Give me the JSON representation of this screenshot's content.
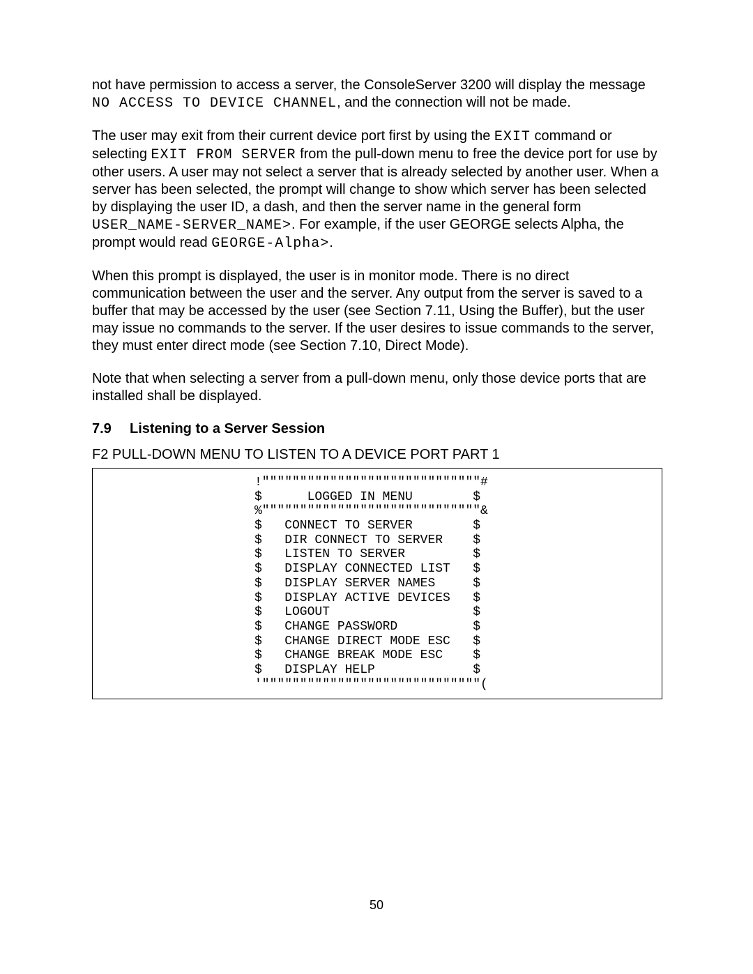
{
  "para1": {
    "t1": "not have permission to access a server, the ConsoleServer 3200 will display the message ",
    "code1": "NO ACCESS TO DEVICE CHANNEL",
    "t2": ", and the connection will not be made."
  },
  "para2": {
    "t1": "The user may exit from their current device port first by using the ",
    "code1": "EXIT",
    "t2": " command or selecting ",
    "code2": "EXIT FROM SERVER",
    "t3": " from the pull-down menu to free the device port for use by other users.  A user may not select a server that is already selected by another user.  When a server has been selected, the prompt will change to show which server has been selected by displaying the user ID, a dash, and then the server name in the general form ",
    "code3": "USER_NAME-SERVER_NAME>",
    "t4": ".  For example, if the user GEORGE selects Alpha, the prompt would read ",
    "code4": "GEORGE-Alpha>",
    "t5": "."
  },
  "para3": {
    "t1": "When this prompt is displayed, the user is in monitor mode.  There is no direct communication between the user and the server.  Any output from the server is saved to a buffer that may be accessed by the user (see Section 7.11, Using the Buffer), but the user may issue no commands to the server.  If the user desires to issue commands to the server, they must enter direct mode (see Section 7.10, Direct Mode)."
  },
  "para4": {
    "t1": "Note that when selecting a server from a pull-down menu, only those device ports that are installed shall be displayed."
  },
  "section": {
    "num": "7.9",
    "title": "Listening to a Server Session"
  },
  "figure": {
    "title": "F2 PULL-DOWN MENU TO LISTEN TO A DEVICE PORT PART 1"
  },
  "menu": {
    "l0": "!\"\"\"\"\"\"\"\"\"\"\"\"\"\"\"\"\"\"\"\"\"\"\"\"\"\"\"\"\"#",
    "l1": "$      LOGGED IN MENU        $",
    "l2": "%\"\"\"\"\"\"\"\"\"\"\"\"\"\"\"\"\"\"\"\"\"\"\"\"\"\"\"\"\"&",
    "l3": "$   CONNECT TO SERVER        $",
    "l4": "$   DIR CONNECT TO SERVER    $",
    "l5": "$   LISTEN TO SERVER         $",
    "l6": "$   DISPLAY CONNECTED LIST   $",
    "l7": "$   DISPLAY SERVER NAMES     $",
    "l8": "$   DISPLAY ACTIVE DEVICES   $",
    "l9": "$   LOGOUT                   $",
    "l10": "$   CHANGE PASSWORD          $",
    "l11": "$   CHANGE DIRECT MODE ESC   $",
    "l12": "$   CHANGE BREAK MODE ESC    $",
    "l13": "$   DISPLAY HELP             $",
    "l14": "'\"\"\"\"\"\"\"\"\"\"\"\"\"\"\"\"\"\"\"\"\"\"\"\"\"\"\"\"\"("
  },
  "page_number": "50"
}
